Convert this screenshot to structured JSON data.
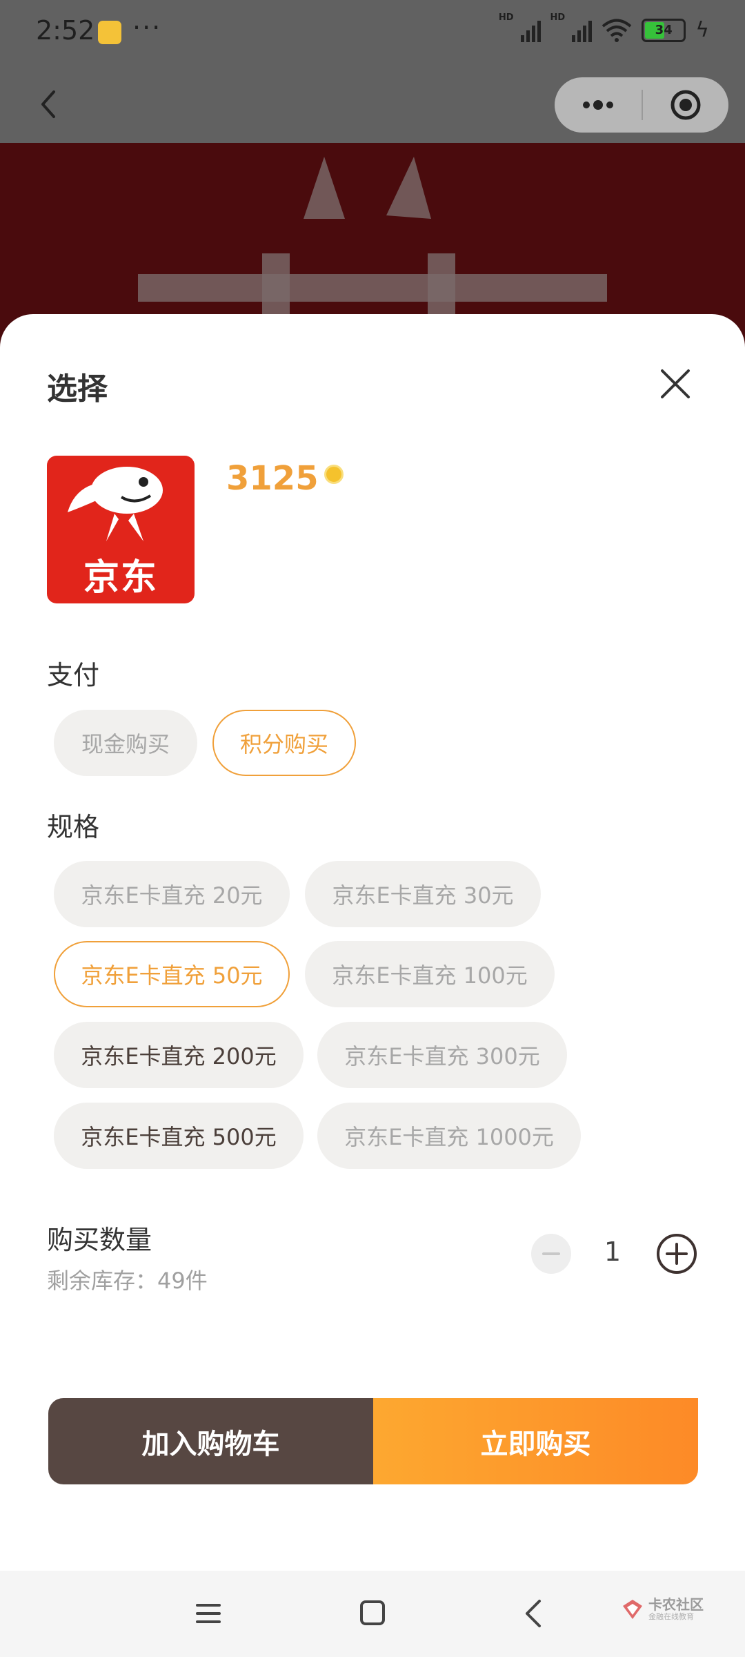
{
  "status_bar": {
    "time": "2:52",
    "more": "···",
    "signal_label": "HD",
    "battery_level": "34",
    "icons": [
      "note-icon",
      "signal-icon",
      "wifi-icon",
      "battery-icon",
      "charging-icon"
    ]
  },
  "nav": {
    "back_icon": "back-arrow-icon",
    "capsule_more": "•••",
    "capsule_close_icon": "target-icon"
  },
  "sheet": {
    "title": "选择",
    "close_icon": "close-icon",
    "product": {
      "logo_text": "京东",
      "logo_brand_color": "#e1251b",
      "price": "3125",
      "price_icon": "coin-icon"
    },
    "payment": {
      "label": "支付",
      "options": [
        {
          "label": "现金购买",
          "selected": false
        },
        {
          "label": "积分购买",
          "selected": true
        }
      ]
    },
    "spec": {
      "label": "规格",
      "options": [
        {
          "label": "京东E卡直充 20元",
          "selected": false
        },
        {
          "label": "京东E卡直充 30元",
          "selected": false
        },
        {
          "label": "京东E卡直充 50元",
          "selected": true
        },
        {
          "label": "京东E卡直充 100元",
          "selected": false
        },
        {
          "label": "京东E卡直充 200元",
          "selected": false
        },
        {
          "label": "京东E卡直充 300元",
          "selected": false
        },
        {
          "label": "京东E卡直充 500元",
          "selected": false
        },
        {
          "label": "京东E卡直充 1000元",
          "selected": false
        }
      ]
    },
    "quantity": {
      "label": "购买数量",
      "stock": "剩余库存：49件",
      "value": "1"
    },
    "actions": {
      "add_to_cart": "加入购物车",
      "buy_now": "立即购买"
    },
    "accent_color": "#f0a03a"
  },
  "system_nav": {
    "icons": [
      "menu-icon",
      "home-icon",
      "back-icon"
    ],
    "watermark_main": "卡农社区",
    "watermark_sub": "金融在线教育"
  }
}
